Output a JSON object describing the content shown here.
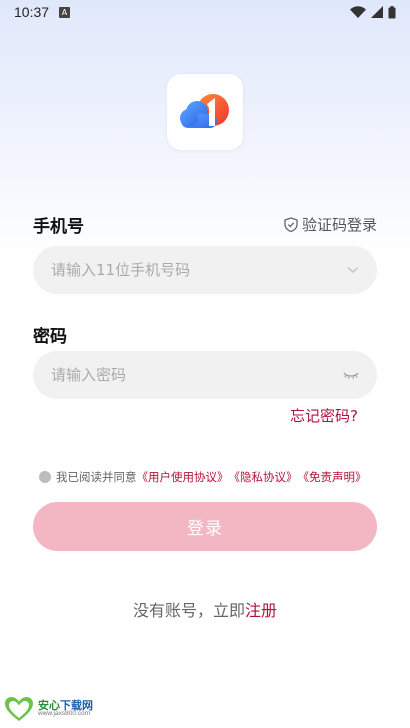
{
  "status_bar": {
    "time": "10:37",
    "notification_letter": "A"
  },
  "form": {
    "phone_label": "手机号",
    "sms_login_label": "验证码登录",
    "phone_placeholder": "请输入11位手机号码",
    "password_label": "密码",
    "password_placeholder": "请输入密码",
    "forgot_password": "忘记密码?",
    "agreement": {
      "prefix": "我已阅读并同意",
      "user_agreement": "《用户使用协议》",
      "privacy_policy": "《隐私协议》",
      "disclaimer": "《免责声明》"
    },
    "login_button": "登录",
    "register_prompt": "没有账号，立即",
    "register_link": "注册"
  },
  "watermark": {
    "title_green": "安心",
    "title_blue": "下载网",
    "url": "www.jaxs800.com",
    "badge": "安心 下载"
  },
  "colors": {
    "accent": "#b3123a",
    "login_button_disabled": "#f2b7c2",
    "input_background": "#f1f1f1"
  }
}
